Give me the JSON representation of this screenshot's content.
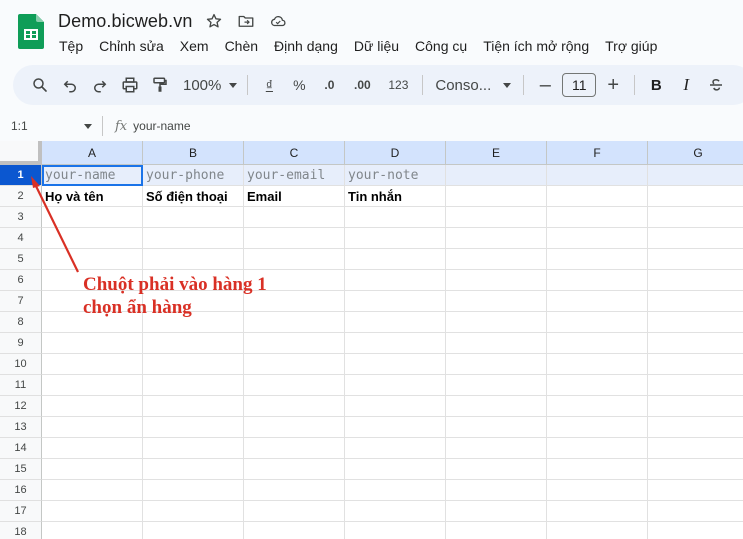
{
  "header": {
    "title": "Demo.bicweb.vn",
    "menu": [
      "Tệp",
      "Chỉnh sửa",
      "Xem",
      "Chèn",
      "Định dạng",
      "Dữ liệu",
      "Công cụ",
      "Tiện ích mở rộng",
      "Trợ giúp"
    ]
  },
  "toolbar": {
    "zoom": "100%",
    "currency": "₫",
    "percent": "%",
    "decrease_decimal": ".0",
    "increase_decimal": ".00",
    "number_format": "123",
    "font": "Conso...",
    "font_size": "11",
    "bold": "B",
    "italic": "I"
  },
  "formula_bar": {
    "name_box": "1:1",
    "fx": "fx",
    "content": "your-name"
  },
  "grid": {
    "columns": [
      "A",
      "B",
      "C",
      "D",
      "E",
      "F",
      "G"
    ],
    "row_numbers": [
      "1",
      "2",
      "3",
      "4",
      "5",
      "6",
      "7",
      "8",
      "9",
      "10",
      "11",
      "12",
      "13",
      "14",
      "15",
      "16",
      "17",
      "18"
    ],
    "row1": [
      "your-name",
      "your-phone",
      "your-email",
      "your-note"
    ],
    "row2": [
      "Họ và tên",
      "Số điện thoại",
      "Email",
      "Tin nhắn"
    ]
  },
  "annotation": {
    "line1": "Chuột phải vào hàng 1",
    "line2": "chọn ẩn hàng"
  },
  "colors": {
    "accent": "#0b57d0",
    "annotation": "#d93025",
    "sheets_green": "#0f9d58"
  }
}
